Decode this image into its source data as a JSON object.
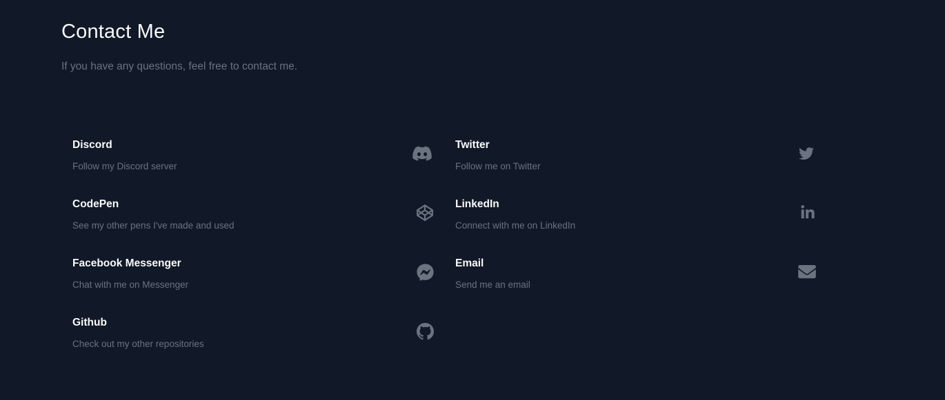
{
  "header": {
    "title": "Contact Me",
    "subtitle": "If you have any questions, feel free to contact me."
  },
  "contacts": {
    "discord": {
      "name": "Discord",
      "description": "Follow my Discord server",
      "icon": "discord-icon"
    },
    "twitter": {
      "name": "Twitter",
      "description": "Follow me on Twitter",
      "icon": "twitter-icon"
    },
    "codepen": {
      "name": "CodePen",
      "description": "See my other pens I've made and used",
      "icon": "codepen-icon"
    },
    "linkedin": {
      "name": "LinkedIn",
      "description": "Connect with me on LinkedIn",
      "icon": "linkedin-icon"
    },
    "messenger": {
      "name": "Facebook Messenger",
      "description": "Chat with me on Messenger",
      "icon": "messenger-icon"
    },
    "email": {
      "name": "Email",
      "description": "Send me an email",
      "icon": "email-icon"
    },
    "github": {
      "name": "Github",
      "description": "Check out my other repositories",
      "icon": "github-icon"
    }
  },
  "colors": {
    "background": "#111827",
    "title": "#f9fafb",
    "muted": "#6b7280",
    "icon": "#6b7280"
  }
}
